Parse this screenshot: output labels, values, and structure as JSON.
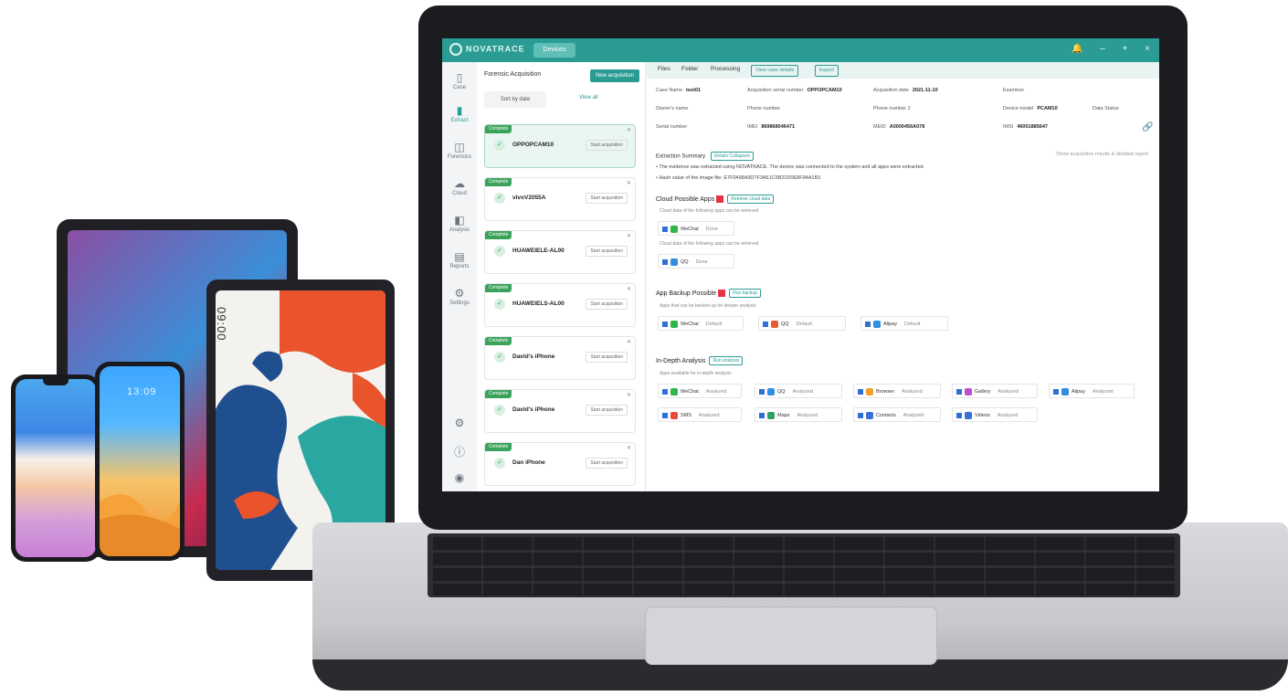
{
  "devices": {
    "phone2_clock": "13:09",
    "tablet_clock": "09:00"
  },
  "app": {
    "logo": "NOVATRACE",
    "device_button": "Devices",
    "window_icons": [
      "bell-icon",
      "minimize-icon",
      "maximize-icon",
      "close-icon"
    ]
  },
  "rail": {
    "items": [
      {
        "label": "Case",
        "icon": "phone-icon"
      },
      {
        "label": "Extract",
        "icon": "extract-icon"
      },
      {
        "label": "Forensics",
        "icon": "forensics-icon"
      },
      {
        "label": "Cloud",
        "icon": "cloud-icon"
      },
      {
        "label": "Analysis",
        "icon": "analysis-icon"
      },
      {
        "label": "Reports",
        "icon": "reports-icon"
      },
      {
        "label": "Settings",
        "icon": "settings-icon"
      }
    ]
  },
  "cases": {
    "title": "Forensic Acquisition",
    "new_button": "New acquisition",
    "filter": "Sort by date",
    "view_all": "View all",
    "list": [
      {
        "tag": "Complete",
        "name": "OPPOPCAM10",
        "status": "Start acquisition"
      },
      {
        "tag": "Complete",
        "name": "vivoV2055A",
        "status": "Start acquisition"
      },
      {
        "tag": "Complete",
        "name": "HUAWEIELE-AL00",
        "status": "Start acquisition"
      },
      {
        "tag": "Complete",
        "name": "HUAWEIELS-AL00",
        "status": "Start acquisition"
      },
      {
        "tag": "Complete",
        "name": "David's iPhone",
        "status": "Start acquisition"
      },
      {
        "tag": "Complete",
        "name": "David's iPhone",
        "status": "Start acquisition"
      },
      {
        "tag": "Complete",
        "name": "Dan iPhone",
        "status": "Start acquisition"
      }
    ]
  },
  "main": {
    "tabs": [
      "Files",
      "Folder",
      "Processing"
    ],
    "tab_pills": [
      "View case details",
      "Export"
    ],
    "fields": [
      {
        "label": "Case Name",
        "value": "test01"
      },
      {
        "label": "Acquisition serial number",
        "value": "OPPOPCAM10"
      },
      {
        "label": "Acquisition date",
        "value": "2021-11-10"
      },
      {
        "label": "Examiner",
        "value": ""
      },
      {
        "label": "Owner's name",
        "value": ""
      },
      {
        "label": "Phone number",
        "value": ""
      },
      {
        "label": "Phone number 2",
        "value": ""
      },
      {
        "label": "Device model",
        "value": "PCAM10"
      },
      {
        "label": "Data Status",
        "value": ""
      },
      {
        "label": "Serial number",
        "value": ""
      },
      {
        "label": "IMEI",
        "value": "869868046471"
      },
      {
        "label": "MEID",
        "value": "A0000456A078"
      },
      {
        "label": "IMSI",
        "value": "46001885647"
      }
    ],
    "summary": "Extraction Summary",
    "summary_btn": "Details Collapsed",
    "summary_right": "Show acquisition results & detailed report",
    "notes": [
      "• The evidence was extracted using NOVATRACE. The device was connected to the system and all apps were extracted.",
      "• Hash value of the image file: E7F0498A9D7F3A61C5B22D0E8F94A1B3"
    ],
    "sections": [
      {
        "title": "Cloud Possible Apps",
        "button": "Retrieve cloud data",
        "subtext": "Cloud data of the following apps can be retrieved"
      },
      {
        "title": "App Backup Possible",
        "button": "Run backup",
        "subtext": "Apps that can be backed up for deeper analysis"
      },
      {
        "title": "In-Depth Analysis",
        "button": "Run analysis",
        "subtext": "Apps available for in-depth analysis"
      }
    ],
    "cloud_apps": [
      {
        "name": "WeChat",
        "state": "Done",
        "color": "#2fb54a"
      },
      {
        "name": "QQ",
        "state": "Done",
        "color": "#2f8ee0"
      }
    ],
    "backup_apps": [
      {
        "name": "WeChat",
        "state": "Default",
        "color": "#2fb54a"
      },
      {
        "name": "QQ",
        "state": "Default",
        "color": "#e0602f"
      },
      {
        "name": "Alipay",
        "state": "Default",
        "color": "#2f8ee0"
      }
    ],
    "analysis_apps": [
      {
        "name": "WeChat",
        "state": "Analyzed",
        "color": "#2fb54a"
      },
      {
        "name": "QQ",
        "state": "Analyzed",
        "color": "#2f8ee0"
      },
      {
        "name": "Browser",
        "state": "Analyzed",
        "color": "#f2a22f"
      },
      {
        "name": "Gallery",
        "state": "Analyzed",
        "color": "#c04fd0"
      },
      {
        "name": "Alipay",
        "state": "Analyzed",
        "color": "#2f8ee0"
      },
      {
        "name": "SMS",
        "state": "Analyzed",
        "color": "#e64a3a"
      },
      {
        "name": "Maps",
        "state": "Analyzed",
        "color": "#2fa06a"
      },
      {
        "name": "Contacts",
        "state": "Analyzed",
        "color": "#3a6fd6"
      },
      {
        "name": "Videos",
        "state": "Analyzed",
        "color": "#3a6fd6"
      }
    ]
  }
}
